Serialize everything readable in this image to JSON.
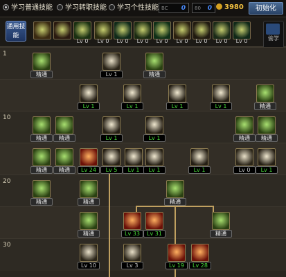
{
  "topbar": {
    "modes": [
      {
        "label": "学习普通技能",
        "selected": true
      },
      {
        "label": "学习转职技能",
        "selected": false
      },
      {
        "label": "学习个性技能",
        "selected": false
      }
    ],
    "points_a": {
      "label": "BC",
      "value": "0"
    },
    "points_b": {
      "label": "80",
      "value": "0"
    },
    "gold": "3980",
    "init_button": "初始化"
  },
  "quickbar": {
    "label": "通用技能",
    "slots": [
      {
        "icon": "running-figure-icon",
        "level": ""
      },
      {
        "icon": "mounted-rider-icon",
        "level": ""
      },
      {
        "icon": "dash-figure-icon",
        "level": "Lv 0"
      },
      {
        "icon": "winged-emblem-icon",
        "level": "Lv 0"
      },
      {
        "icon": "target-crosshair-icon",
        "level": "Lv 0"
      },
      {
        "icon": "star-burst-icon",
        "level": "Lv 0"
      },
      {
        "icon": "green-figure-icon",
        "level": "Lv 0"
      },
      {
        "icon": "bow-archer-icon",
        "level": "Lv 0"
      },
      {
        "icon": "circle-ring-icon",
        "level": "Lv 0"
      },
      {
        "icon": "armored-warrior-icon",
        "level": "Lv 0"
      },
      {
        "icon": "jump-figure-icon",
        "level": "Lv 0"
      }
    ],
    "side_label": "偷学"
  },
  "tree": {
    "rows": [
      {
        "num": "1"
      },
      {
        "num": ""
      },
      {
        "num": "10"
      },
      {
        "num": ""
      },
      {
        "num": "20"
      },
      {
        "num": ""
      },
      {
        "num": "30"
      }
    ],
    "nodes": [
      {
        "icon": "dagger-slash-icon",
        "badge": "精通",
        "kind": "learn"
      },
      {
        "icon": "sword-strike-icon",
        "badge": "Lv 1",
        "kind": "lv"
      },
      {
        "icon": "claw-scratch-icon",
        "badge": "精通",
        "kind": "learn"
      },
      {
        "icon": "crossed-blades-icon",
        "badge": "Lv 1",
        "kind": "lvg"
      },
      {
        "icon": "arrow-thrust-icon",
        "badge": "Lv 1",
        "kind": "lvg"
      },
      {
        "icon": "spiral-slash-icon",
        "badge": "Lv 1",
        "kind": "lvg"
      },
      {
        "icon": "holy-cross-icon",
        "badge": "Lv 1",
        "kind": "lvg"
      },
      {
        "icon": "rune-blade-icon",
        "badge": "精通",
        "kind": "learn"
      },
      {
        "icon": "green-sword-icon",
        "badge": "精通",
        "kind": "learn"
      },
      {
        "icon": "green-spear-icon",
        "badge": "精通",
        "kind": "learn"
      },
      {
        "icon": "fire-kick-icon",
        "badge": "Lv 1",
        "kind": "lvg"
      },
      {
        "icon": "whirl-slash-icon",
        "badge": "Lv 1",
        "kind": "lvg"
      },
      {
        "icon": "green-lance-icon",
        "badge": "精通",
        "kind": "learn"
      },
      {
        "icon": "green-crescent-icon",
        "badge": "精通",
        "kind": "learn"
      },
      {
        "icon": "green-blade-icon",
        "badge": "精通",
        "kind": "learn"
      },
      {
        "icon": "green-burst-icon",
        "badge": "精通",
        "kind": "learn"
      },
      {
        "icon": "red-cross-icon",
        "badge": "Lv 24",
        "kind": "lvg"
      },
      {
        "icon": "twin-slash-icon",
        "badge": "Lv 5",
        "kind": "lvg"
      },
      {
        "icon": "leap-strike-icon",
        "badge": "Lv 1",
        "kind": "lvg"
      },
      {
        "icon": "spin-kick-icon",
        "badge": "Lv 1",
        "kind": "lvg"
      },
      {
        "icon": "cross-parry-icon",
        "badge": "Lv 1",
        "kind": "lvg"
      },
      {
        "icon": "moon-arc-icon",
        "badge": "Lv 0",
        "kind": "lv"
      },
      {
        "icon": "lightning-claw-icon",
        "badge": "Lv 1",
        "kind": "lvg"
      },
      {
        "icon": "trident-icon",
        "badge": "精通",
        "kind": "learn"
      },
      {
        "icon": "green-slash-icon",
        "badge": "精通",
        "kind": "learn"
      },
      {
        "icon": "flow-glyph-icon",
        "badge": "精通",
        "kind": "learn"
      },
      {
        "icon": "golden-figure-icon",
        "badge": "精通",
        "kind": "learn"
      },
      {
        "icon": "red-shard-icon",
        "badge": "Lv 33",
        "kind": "lvg"
      },
      {
        "icon": "red-swirl-icon",
        "badge": "Lv 31",
        "kind": "lvg"
      },
      {
        "icon": "holy-sword-icon",
        "badge": "精通",
        "kind": "learn"
      },
      {
        "icon": "swift-step-icon",
        "badge": "Lv 10",
        "kind": "lv"
      },
      {
        "icon": "thrust-dash-icon",
        "badge": "Lv 3",
        "kind": "lv"
      },
      {
        "icon": "flame-flow-icon",
        "badge": "Lv 19",
        "kind": "lvg"
      },
      {
        "icon": "flame-strike-icon",
        "badge": "Lv 28",
        "kind": "lvg"
      }
    ],
    "colors": {
      "learned_border": "#8a7a50",
      "green_level": "#4adf3a",
      "link_line": "#c0a060"
    }
  }
}
